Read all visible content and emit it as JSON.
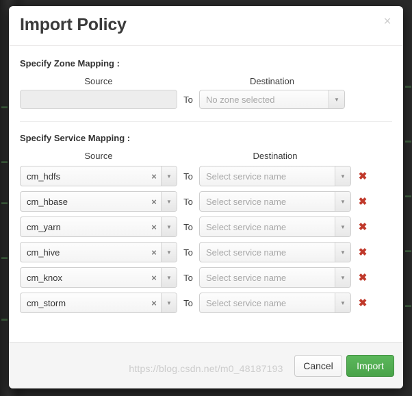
{
  "modal": {
    "title": "Import Policy",
    "close_icon": "close-icon"
  },
  "zone_mapping": {
    "section_label": "Specify Zone Mapping :",
    "source_header": "Source",
    "destination_header": "Destination",
    "to_label": "To",
    "source_value": "",
    "source_placeholder": "",
    "destination_value": "No zone selected",
    "caret_icon": "chevron-down-icon"
  },
  "service_mapping": {
    "section_label": "Specify Service Mapping :",
    "source_header": "Source",
    "destination_header": "Destination",
    "to_label": "To",
    "destination_placeholder": "Select service name",
    "clear_icon": "clear-icon",
    "caret_icon": "chevron-down-icon",
    "delete_icon": "delete-icon",
    "rows": [
      {
        "source": "cm_hdfs",
        "destination": "Select service name"
      },
      {
        "source": "cm_hbase",
        "destination": "Select service name"
      },
      {
        "source": "cm_yarn",
        "destination": "Select service name"
      },
      {
        "source": "cm_hive",
        "destination": "Select service name"
      },
      {
        "source": "cm_knox",
        "destination": "Select service name"
      },
      {
        "source": "cm_storm",
        "destination": "Select service name"
      }
    ]
  },
  "footer": {
    "cancel_label": "Cancel",
    "import_label": "Import"
  },
  "watermark": {
    "text": "https://blog.csdn.net/m0_48187193"
  },
  "colors": {
    "import_green": "#5cb85c",
    "delete_red": "#c0392b",
    "title_gray": "#3a3a3a",
    "placeholder_gray": "#a8a8a8",
    "backdrop": "#262626"
  }
}
